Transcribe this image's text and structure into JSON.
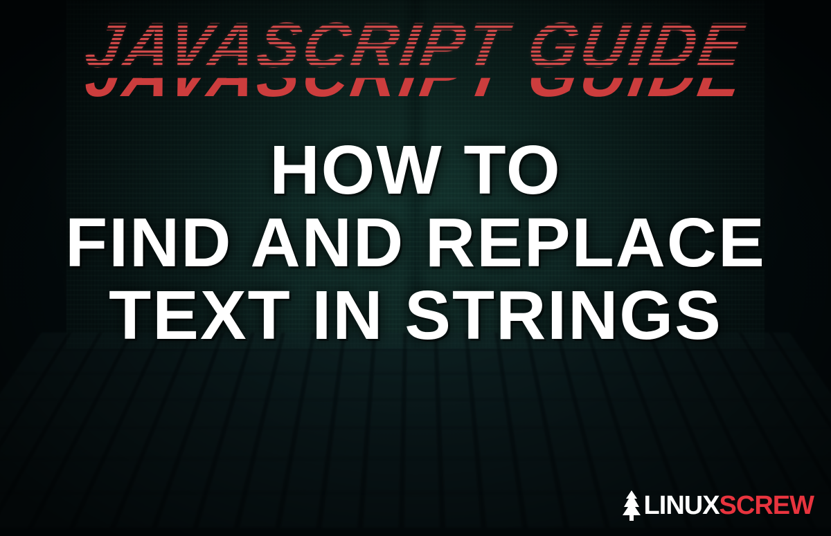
{
  "hero": {
    "overline": "JAVASCRIPT GUIDE",
    "title_line1": "HOW TO",
    "title_line2": "FIND AND REPLACE",
    "title_line3": "TEXT IN STRINGS"
  },
  "branding": {
    "logo_part1": "LINUX",
    "logo_part2": "SCREW"
  },
  "colors": {
    "overline_color": "#d94b4b",
    "title_color": "#ffffff",
    "brand_accent": "#e8343e",
    "background_tint": "#0a1518"
  }
}
